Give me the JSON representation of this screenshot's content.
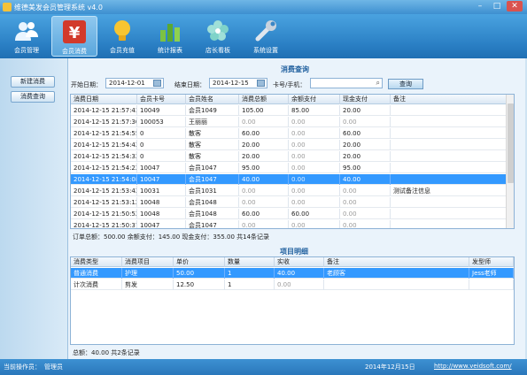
{
  "window": {
    "title": "维德美发会员管理系统 v4.0",
    "min": "–",
    "max": "□",
    "close": "✕"
  },
  "toolbar": {
    "items": [
      {
        "label": "会员管理",
        "icon": "members-icon"
      },
      {
        "label": "会员消费",
        "icon": "yen-icon",
        "active": true
      },
      {
        "label": "会员充值",
        "icon": "lightbulb-icon"
      },
      {
        "label": "统计报表",
        "icon": "bar-chart-icon"
      },
      {
        "label": "店长看板",
        "icon": "flower-icon"
      },
      {
        "label": "系统设置",
        "icon": "wrench-icon"
      }
    ]
  },
  "sidebar": {
    "items": [
      {
        "label": "新建消费"
      },
      {
        "label": "消费查询"
      }
    ]
  },
  "query": {
    "title": "消费查询",
    "start_label": "开始日期：",
    "start_value": "2014-12-01",
    "end_label": "结束日期：",
    "end_value": "2014-12-15",
    "card_label": "卡号/手机：",
    "card_value": "",
    "search_label": "查询"
  },
  "orders": {
    "columns": [
      "消费日期",
      "会员卡号",
      "会员姓名",
      "消费总额",
      "余额支付",
      "现金支付",
      "备注"
    ],
    "rows": [
      [
        "2014-12-15 21:57:43",
        "10049",
        "会员1049",
        "105.00",
        "85.00",
        "20.00",
        ""
      ],
      [
        "2014-12-15 21:57:30",
        "100053",
        "王丽丽",
        "0.00",
        "0.00",
        "0.00",
        ""
      ],
      [
        "2014-12-15 21:54:55",
        "0",
        "散客",
        "60.00",
        "0.00",
        "60.00",
        ""
      ],
      [
        "2014-12-15 21:54:42",
        "0",
        "散客",
        "20.00",
        "0.00",
        "20.00",
        ""
      ],
      [
        "2014-12-15 21:54:32",
        "0",
        "散客",
        "20.00",
        "0.00",
        "20.00",
        ""
      ],
      [
        "2014-12-15 21:54:22",
        "10047",
        "会员1047",
        "95.00",
        "0.00",
        "95.00",
        ""
      ],
      [
        "2014-12-15 21:54:08",
        "10047",
        "会员1047",
        "40.00",
        "0.00",
        "40.00",
        ""
      ],
      [
        "2014-12-15 21:53:42",
        "10031",
        "会员1031",
        "0.00",
        "0.00",
        "0.00",
        "测试备注信息"
      ],
      [
        "2014-12-15 21:53:12",
        "10048",
        "会员1048",
        "0.00",
        "0.00",
        "0.00",
        ""
      ],
      [
        "2014-12-15 21:50:52",
        "10048",
        "会员1048",
        "60.00",
        "60.00",
        "0.00",
        ""
      ],
      [
        "2014-12-15 21:50:37",
        "10047",
        "会员1047",
        "0.00",
        "0.00",
        "0.00",
        ""
      ]
    ],
    "selected_index": 6,
    "summary": "订单总额：500.00   余额支付：145.00   现金支付：355.00   共14条记录"
  },
  "details": {
    "title": "项目明细",
    "columns": [
      "消费类型",
      "消费项目",
      "单价",
      "数量",
      "实收",
      "备注",
      "发型师"
    ],
    "rows": [
      [
        "普通消费",
        "护理",
        "50.00",
        "1",
        "40.00",
        "老顾客",
        "Jess老师"
      ],
      [
        "计次消费",
        "剪发",
        "12.50",
        "1",
        "0.00",
        "",
        ""
      ]
    ],
    "selected_index": 0,
    "summary": "总额：40.00     共2条记录"
  },
  "status": {
    "operator_label": "当前操作员：",
    "operator_value": "管理员",
    "date": "2014年12月15日",
    "website": "http://www.veidsoft.com/"
  }
}
